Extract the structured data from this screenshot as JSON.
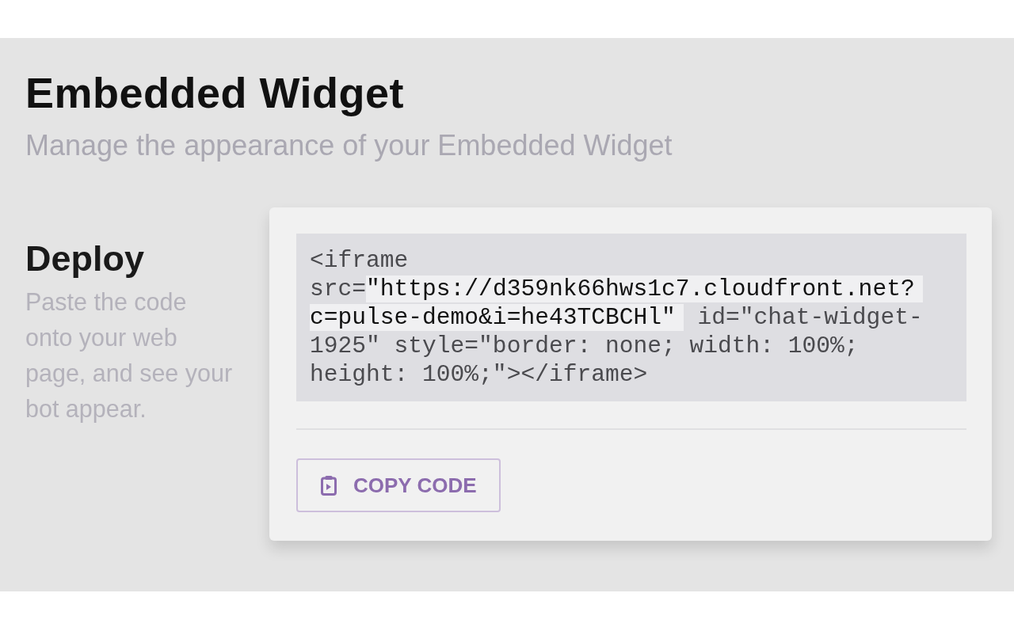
{
  "page": {
    "title": "Embedded Widget",
    "subtitle": "Manage the appearance of your Embedded Widget"
  },
  "deploy": {
    "heading": "Deploy",
    "description": "Paste the code onto your web page, and see your bot appear."
  },
  "code_block": {
    "segments": [
      {
        "text": "<iframe src=",
        "highlighted": false
      },
      {
        "text": "\"https://d359nk66hws1c7.cloudfront.net?c=pulse-demo&i=he43TCBCHl\"",
        "highlighted": true
      },
      {
        "text": " id=\"chat-widget-1925\" style=\"border: none; width: 100%; height: 100%;\"></iframe>",
        "highlighted": false
      }
    ]
  },
  "copy_button": {
    "label": "COPY CODE"
  }
}
